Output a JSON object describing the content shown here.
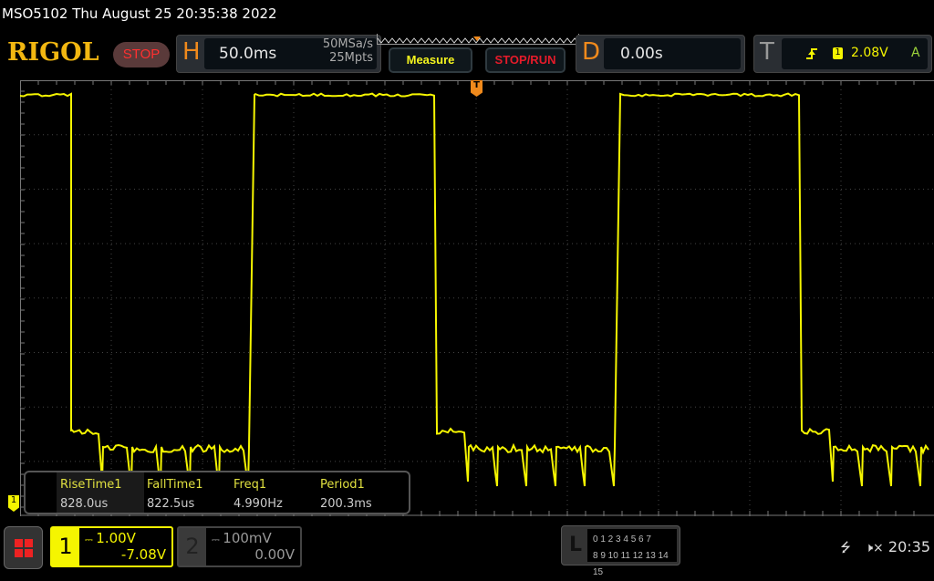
{
  "title": "MSO5102  Thu August 25 20:35:38 2022",
  "logo": "RIGOL",
  "run_state": "STOP",
  "horizontal": {
    "letter": "H",
    "timebase": "50.0ms",
    "sample_rate": "50MSa/s",
    "memory_depth": "25Mpts"
  },
  "buttons": {
    "measure": "Measure",
    "stop_run": "STOP/RUN"
  },
  "delay": {
    "letter": "D",
    "value": "0.00s"
  },
  "trigger": {
    "letter": "T",
    "edge_icon": "rising-edge-icon",
    "source": "1",
    "level": "2.08V",
    "mode": "A",
    "marker": "T"
  },
  "measurements": [
    {
      "label": "RiseTime1",
      "value": "828.0us"
    },
    {
      "label": "FallTime1",
      "value": "822.5us"
    },
    {
      "label": "Freq1",
      "value": "4.990Hz"
    },
    {
      "label": "Period1",
      "value": "200.3ms"
    }
  ],
  "channels": [
    {
      "num": "1",
      "scale": "1.00V",
      "offset": "-7.08V",
      "color": "#f5f500",
      "coupling_icon": "dc-coupling-icon"
    },
    {
      "num": "2",
      "scale": "100mV",
      "offset": "0.00V",
      "color": "#888888",
      "coupling_icon": "dc-coupling-icon"
    }
  ],
  "ch1_marker": "1",
  "logic": {
    "letter": "L",
    "row1": "0 1 2 3  4 5 6 7",
    "row2": "8 9 10 11 12 13 14 15"
  },
  "status": {
    "clock": "20:35",
    "usb_icon": "usb-icon",
    "sound_icon": "mute-icon"
  }
}
